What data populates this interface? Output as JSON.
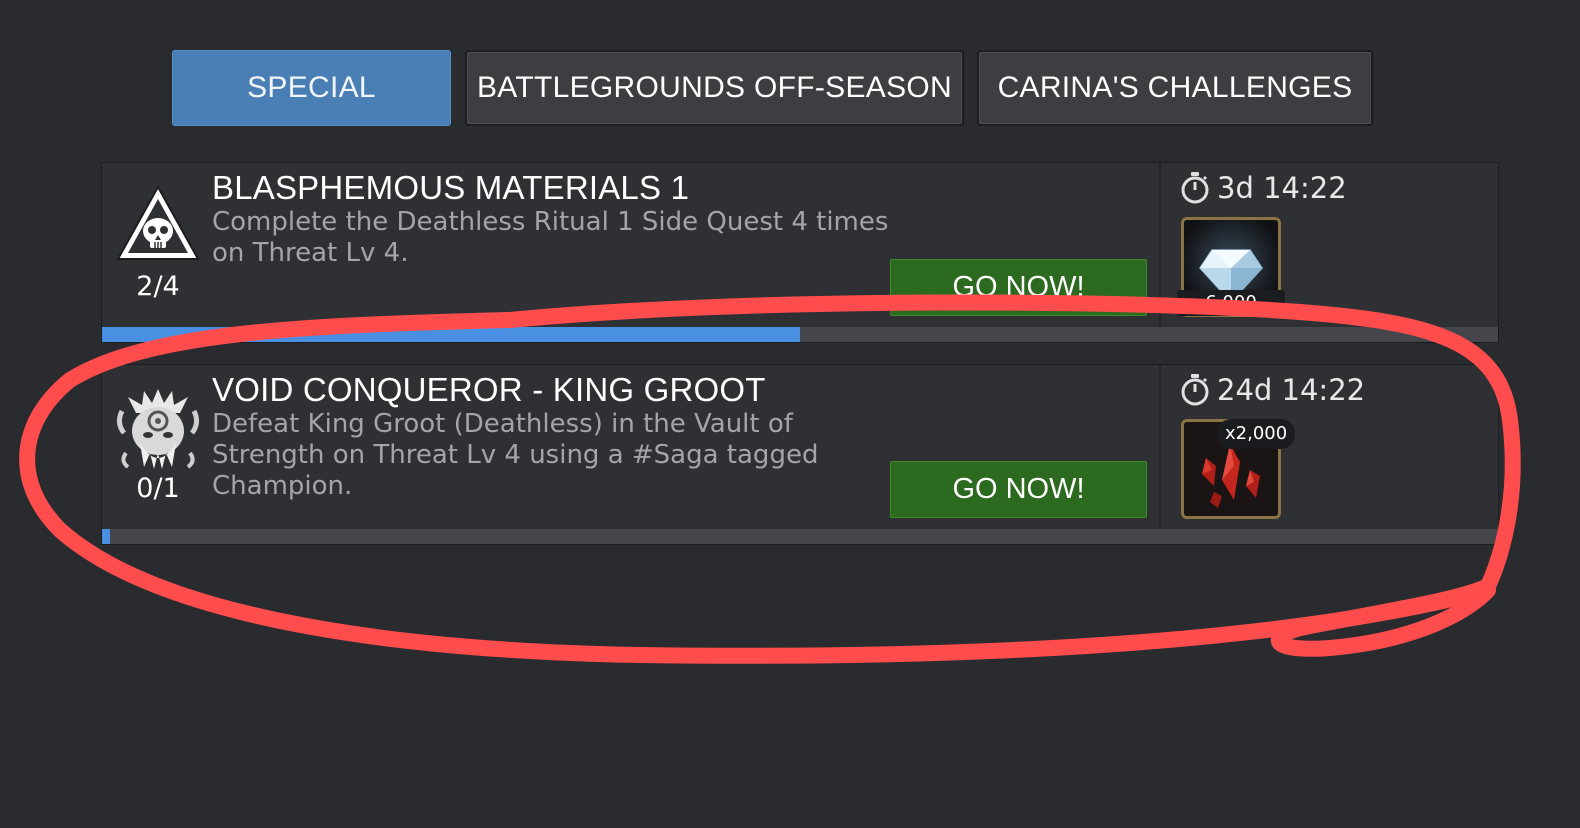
{
  "tabs": [
    {
      "label": "SPECIAL",
      "active": true
    },
    {
      "label": "BATTLEGROUNDS OFF-SEASON",
      "active": false
    },
    {
      "label": "CARINA'S CHALLENGES",
      "active": false
    }
  ],
  "quests": [
    {
      "title": "BLASPHEMOUS MATERIALS 1",
      "description": "Complete the Deathless Ritual 1 Side Quest 4 times on Threat Lv 4.",
      "progress_text": "2/4",
      "progress_fraction": 0.5,
      "button_label": "GO NOW!",
      "timer": "3d 14:22",
      "icon": "skull-warning-icon",
      "reward_icon": "crystal-gem-icon",
      "reward_count": "6,000"
    },
    {
      "title": "VOID CONQUEROR - KING GROOT",
      "description": "Defeat King Groot (Deathless) in the Vault of Strength on Threat Lv 4 using a #Saga tagged Champion.",
      "progress_text": "0/1",
      "progress_fraction": 0.0,
      "button_label": "GO NOW!",
      "timer": "24d 14:22",
      "icon": "king-groot-icon",
      "reward_icon": "red-shards-icon",
      "reward_count": "x2,000"
    }
  ],
  "colors": {
    "background": "#2a2b2f",
    "tab_active": "#4a7fb5",
    "button_green": "#2c6a1f",
    "progress_blue": "#4a90e2",
    "annotation_red": "#ff4d4d"
  }
}
